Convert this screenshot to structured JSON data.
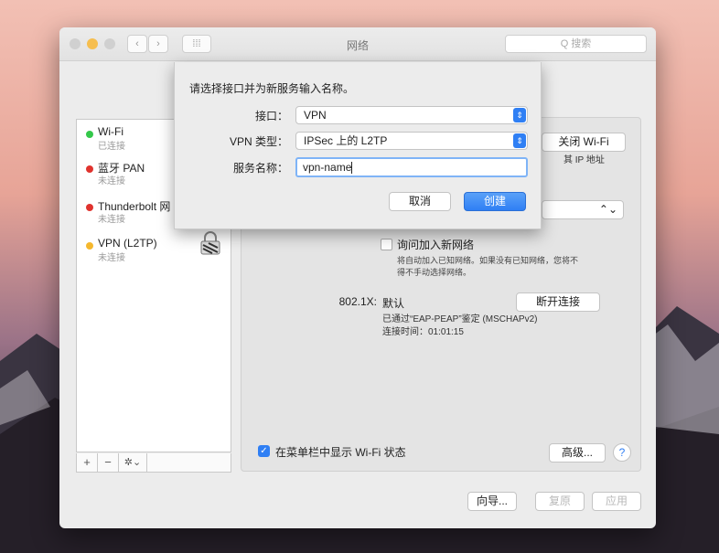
{
  "window": {
    "title": "网络",
    "search_placeholder": "Q 搜索"
  },
  "sidebar": {
    "items": [
      {
        "name": "Wi-Fi",
        "status": "已连接",
        "color": "#34c84a"
      },
      {
        "name": "蓝牙 PAN",
        "status": "未连接",
        "color": "#e0332e"
      },
      {
        "name": "Thunderbolt 网",
        "status": "未连接",
        "color": "#e0332e"
      },
      {
        "name": "VPN (L2TP)",
        "status": "未连接",
        "color": "#f5b82e"
      }
    ],
    "tools": {
      "add": "+",
      "remove": "−",
      "action": "✲⌄"
    }
  },
  "panel": {
    "turn_off_wifi": "关闭 Wi-Fi",
    "ip_note": "其 IP 地址",
    "ask_join": "询问加入新网络",
    "ask_join_desc_1": "将自动加入已知网络。如果没有已知网络，您将不",
    "ask_join_desc_2": "得不手动选择网络。",
    "dot1x_label": "802.1X:",
    "dot1x_value": "默认",
    "disconnect": "断开连接",
    "auth_line": "已通过“EAP-PEAP”鉴定 (MSCHAPv2)",
    "conn_time": "连接时间：01:01:15",
    "show_menubar": "在菜单栏中显示 Wi-Fi 状态",
    "advanced": "高级...",
    "help": "?"
  },
  "bottom": {
    "assist": "向导...",
    "revert": "复原",
    "apply": "应用"
  },
  "sheet": {
    "prompt": "请选择接口并为新服务输入名称。",
    "interface_label": "接口：",
    "interface_value": "VPN",
    "vpn_type_label": "VPN 类型：",
    "vpn_type_value": "IPSec 上的 L2TP",
    "service_label": "服务名称：",
    "service_value": "vpn-name",
    "cancel": "取消",
    "create": "创建"
  }
}
